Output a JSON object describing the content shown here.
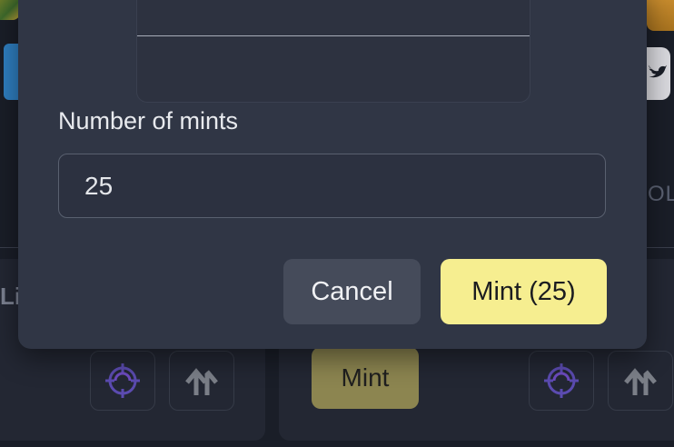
{
  "modal": {
    "field_label": "Number of mints",
    "input_value": "25",
    "cancel_label": "Cancel",
    "confirm_label": "Mint (25)"
  },
  "background": {
    "partial_text_left": "Li",
    "partial_text_right": "OL",
    "mint_button_label": "Mint",
    "icons": [
      "target-icon",
      "upload-arrows-icon",
      "twitter-icon"
    ]
  },
  "colors": {
    "accent": "#f6ee90",
    "modal_bg": "#303645",
    "page_bg": "#1a1e28"
  }
}
